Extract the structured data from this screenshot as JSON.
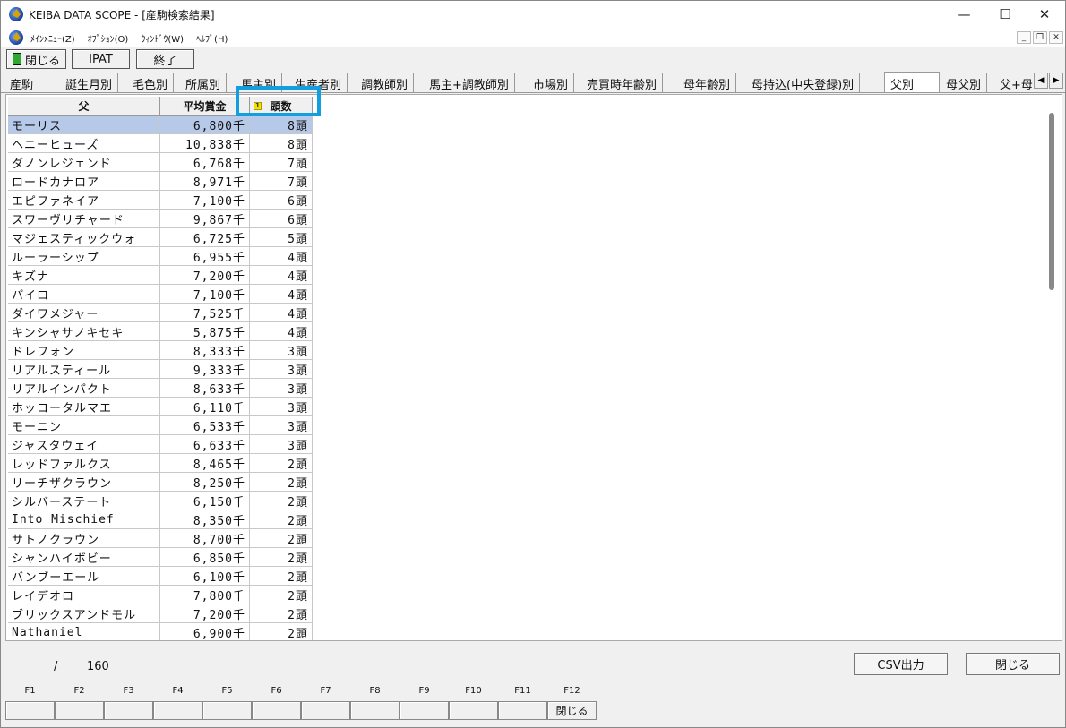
{
  "window": {
    "title": "KEIBA DATA SCOPE - [産駒検索結果]"
  },
  "menubar": [
    "ﾒｲﾝﾒﾆｭｰ(Z)",
    "ｵﾌﾟｼｮﾝ(O)",
    "ｳｨﾝﾄﾞｳ(W)",
    "ﾍﾙﾌﾟ(H)"
  ],
  "toolbar": {
    "close": "閉じる",
    "ipat": "IPAT",
    "exit": "終了"
  },
  "tabs": [
    "産駒",
    "誕生月別",
    "毛色別",
    "所属別",
    "馬主別",
    "生産者別",
    "調教師別",
    "馬主+調教師別",
    "市場別",
    "売買時年齢別",
    "母年齢別",
    "母持込(中央登録)別",
    "父別",
    "母父別",
    "父+母"
  ],
  "active_tab": "父別",
  "table": {
    "headers": [
      "父",
      "平均賞金",
      "頭数"
    ],
    "sort_badge": "1",
    "rows": [
      [
        "モーリス",
        "6,800千",
        "8頭"
      ],
      [
        "ヘニーヒューズ",
        "10,838千",
        "8頭"
      ],
      [
        "ダノンレジェンド",
        "6,768千",
        "7頭"
      ],
      [
        "ロードカナロア",
        "8,971千",
        "7頭"
      ],
      [
        "エピファネイア",
        "7,100千",
        "6頭"
      ],
      [
        "スワーヴリチャード",
        "9,867千",
        "6頭"
      ],
      [
        "マジェスティックウォ",
        "6,725千",
        "5頭"
      ],
      [
        "ルーラーシップ",
        "6,955千",
        "4頭"
      ],
      [
        "キズナ",
        "7,200千",
        "4頭"
      ],
      [
        "パイロ",
        "7,100千",
        "4頭"
      ],
      [
        "ダイワメジャー",
        "7,525千",
        "4頭"
      ],
      [
        "キンシャサノキセキ",
        "5,875千",
        "4頭"
      ],
      [
        "ドレフォン",
        "8,333千",
        "3頭"
      ],
      [
        "リアルスティール",
        "9,333千",
        "3頭"
      ],
      [
        "リアルインパクト",
        "8,633千",
        "3頭"
      ],
      [
        "ホッコータルマエ",
        "6,110千",
        "3頭"
      ],
      [
        "モーニン",
        "6,533千",
        "3頭"
      ],
      [
        "ジャスタウェイ",
        "6,633千",
        "3頭"
      ],
      [
        "レッドファルクス",
        "8,465千",
        "2頭"
      ],
      [
        "リーチザクラウン",
        "8,250千",
        "2頭"
      ],
      [
        "シルバーステート",
        "6,150千",
        "2頭"
      ],
      [
        "Into Mischief",
        "8,350千",
        "2頭"
      ],
      [
        "サトノクラウン",
        "8,700千",
        "2頭"
      ],
      [
        "シャンハイボビー",
        "6,850千",
        "2頭"
      ],
      [
        "バンブーエール",
        "6,100千",
        "2頭"
      ],
      [
        "レイデオロ",
        "7,800千",
        "2頭"
      ],
      [
        "ブリックスアンドモル",
        "7,200千",
        "2頭"
      ],
      [
        "Nathaniel",
        "6,900千",
        "2頭"
      ]
    ]
  },
  "status": {
    "separator": "/",
    "total": "160",
    "csv_button": "CSV出力",
    "close_button": "閉じる"
  },
  "fkeys": [
    {
      "key": "F1",
      "label": ""
    },
    {
      "key": "F2",
      "label": ""
    },
    {
      "key": "F3",
      "label": ""
    },
    {
      "key": "F4",
      "label": ""
    },
    {
      "key": "F5",
      "label": ""
    },
    {
      "key": "F6",
      "label": ""
    },
    {
      "key": "F7",
      "label": ""
    },
    {
      "key": "F8",
      "label": ""
    },
    {
      "key": "F9",
      "label": ""
    },
    {
      "key": "F10",
      "label": ""
    },
    {
      "key": "F11",
      "label": ""
    },
    {
      "key": "F12",
      "label": "閉じる"
    }
  ]
}
